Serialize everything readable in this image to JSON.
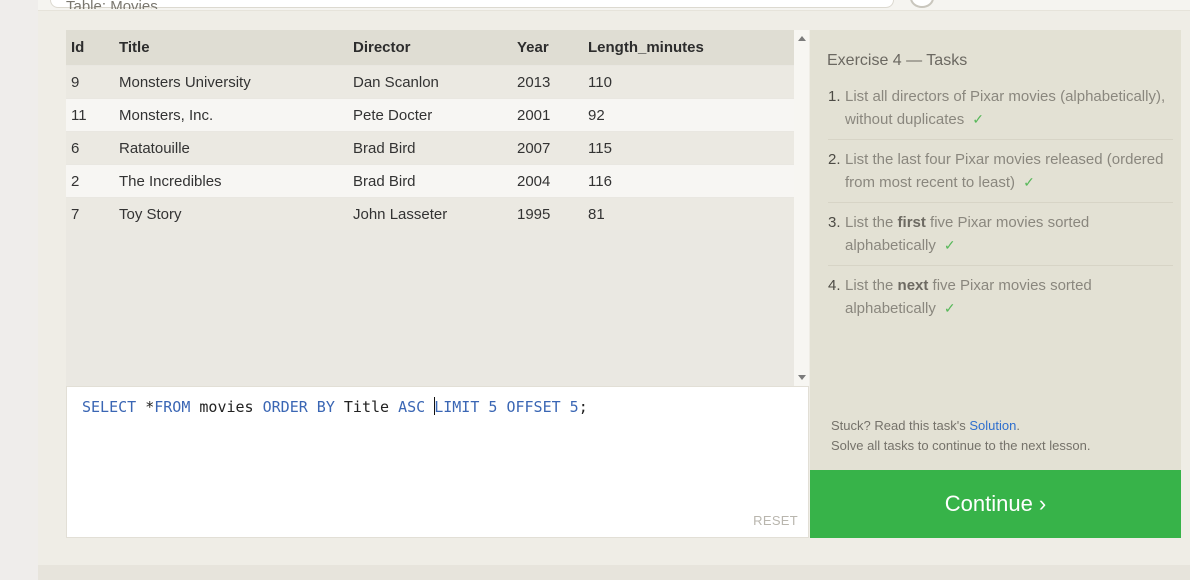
{
  "table_caption": "Table: Movies",
  "table": {
    "columns": [
      "Id",
      "Title",
      "Director",
      "Year",
      "Length_minutes"
    ],
    "rows": [
      [
        "9",
        "Monsters University",
        "Dan Scanlon",
        "2013",
        "110"
      ],
      [
        "11",
        "Monsters, Inc.",
        "Pete Docter",
        "2001",
        "92"
      ],
      [
        "6",
        "Ratatouille",
        "Brad Bird",
        "2007",
        "115"
      ],
      [
        "2",
        "The Incredibles",
        "Brad Bird",
        "2004",
        "116"
      ],
      [
        "7",
        "Toy Story",
        "John Lasseter",
        "1995",
        "81"
      ]
    ]
  },
  "editor": {
    "query_tokens": {
      "select": "SELECT",
      "star": " *",
      "from": "FROM",
      "movies": " movies ",
      "order_by": "ORDER BY",
      "title": " Title ",
      "asc": "ASC",
      "space": " ",
      "limit": "LIMIT",
      "limit_num": " 5",
      "offset": " OFFSET",
      "offset_num": " 5",
      "semicolon": ";"
    },
    "reset_label": "RESET"
  },
  "tasks": {
    "title": "Exercise 4 — Tasks",
    "items": [
      {
        "num": "1.",
        "text_before": "List all directors of Pixar movies (alphabetically), without duplicates",
        "bold": "",
        "text_after": "",
        "check": "✓"
      },
      {
        "num": "2.",
        "text_before": "List the last four Pixar movies released (ordered from most recent to least)",
        "bold": "",
        "text_after": "",
        "check": "✓"
      },
      {
        "num": "3.",
        "text_before": "List the ",
        "bold": "first",
        "text_after": " five Pixar movies sorted alphabetically",
        "check": "✓"
      },
      {
        "num": "4.",
        "text_before": "List the ",
        "bold": "next",
        "text_after": " five Pixar movies sorted alphabetically",
        "check": "✓"
      }
    ],
    "stuck_prefix": "Stuck? Read this task's ",
    "solution_link": "Solution",
    "stuck_suffix": ".",
    "solve_all": "Solve all tasks to continue to the next lesson."
  },
  "continue_label": "Continue ›",
  "colors": {
    "continue_bg": "#37b349",
    "keyword": "#3a66b4",
    "check": "#58b85a",
    "link": "#2f6fce"
  }
}
